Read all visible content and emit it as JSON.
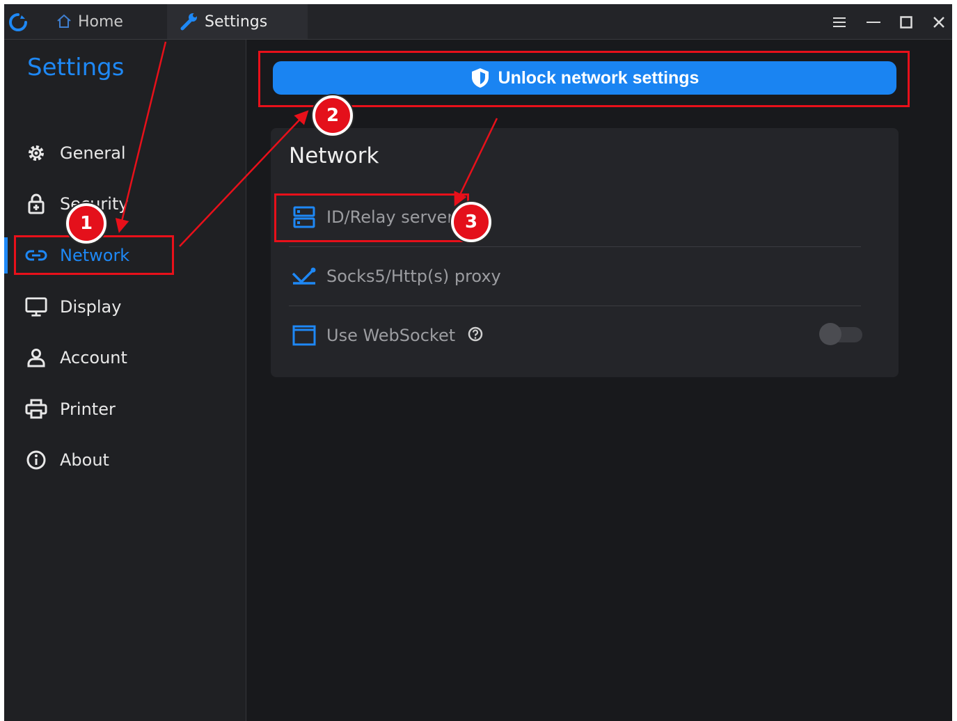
{
  "titlebar": {
    "tabs": [
      {
        "label": "Home",
        "icon": "home-icon"
      },
      {
        "label": "Settings",
        "icon": "wrench-icon"
      }
    ],
    "controls": [
      "menu-icon",
      "minimize-icon",
      "maximize-icon",
      "close-icon"
    ]
  },
  "sidebar": {
    "title": "Settings",
    "items": [
      {
        "label": "General",
        "icon": "gear-icon"
      },
      {
        "label": "Security",
        "icon": "lock-icon"
      },
      {
        "label": "Network",
        "icon": "link-icon",
        "active": true
      },
      {
        "label": "Display",
        "icon": "monitor-icon"
      },
      {
        "label": "Account",
        "icon": "user-icon"
      },
      {
        "label": "Printer",
        "icon": "printer-icon"
      },
      {
        "label": "About",
        "icon": "info-icon"
      }
    ]
  },
  "main": {
    "unlock_button": "Unlock network settings",
    "card": {
      "title": "Network",
      "rows": [
        {
          "label": "ID/Relay server",
          "icon": "server-icon"
        },
        {
          "label": "Socks5/Http(s) proxy",
          "icon": "proxy-icon"
        },
        {
          "label": "Use WebSocket",
          "icon": "window-icon",
          "toggle": false
        }
      ]
    }
  },
  "annotations": {
    "badges": [
      "1",
      "2",
      "3"
    ]
  },
  "colors": {
    "accent": "#1e88f5",
    "background": "#18191c",
    "annotation": "#e8101a"
  }
}
